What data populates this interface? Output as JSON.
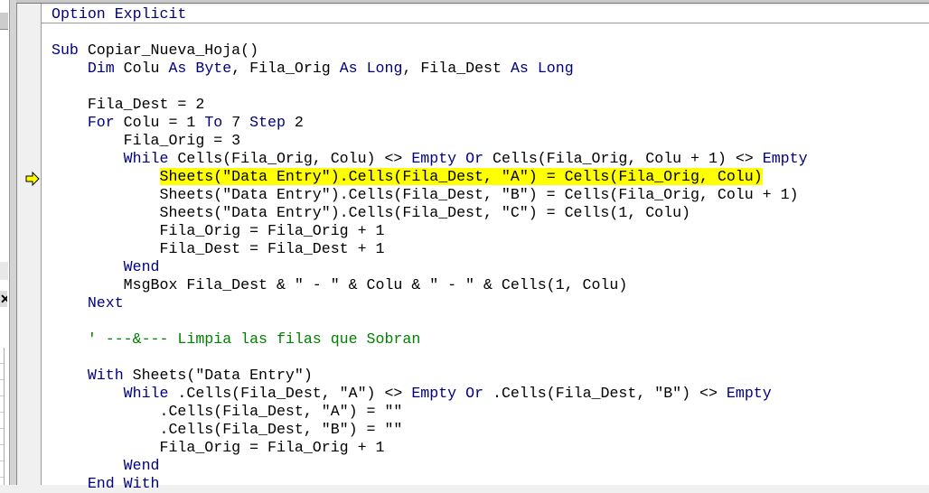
{
  "editor": {
    "execution_line": 10,
    "highlight_color": "#ffff00",
    "keyword_color": "#00007f",
    "comment_color": "#007f00",
    "lines": [
      [
        [
          "k",
          "Option Explicit"
        ]
      ],
      [],
      [
        [
          "k",
          "Sub"
        ],
        [
          "n",
          " Copiar_Nueva_Hoja()"
        ]
      ],
      [
        [
          "n",
          "    "
        ],
        [
          "k",
          "Dim"
        ],
        [
          "n",
          " Colu "
        ],
        [
          "k",
          "As"
        ],
        [
          "n",
          " "
        ],
        [
          "k",
          "Byte"
        ],
        [
          "n",
          ", Fila_Orig "
        ],
        [
          "k",
          "As"
        ],
        [
          "n",
          " "
        ],
        [
          "k",
          "Long"
        ],
        [
          "n",
          ", Fila_Dest "
        ],
        [
          "k",
          "As"
        ],
        [
          "n",
          " "
        ],
        [
          "k",
          "Long"
        ]
      ],
      [],
      [
        [
          "n",
          "    Fila_Dest = 2"
        ]
      ],
      [
        [
          "n",
          "    "
        ],
        [
          "k",
          "For"
        ],
        [
          "n",
          " Colu = 1 "
        ],
        [
          "k",
          "To"
        ],
        [
          "n",
          " 7 "
        ],
        [
          "k",
          "Step"
        ],
        [
          "n",
          " 2"
        ]
      ],
      [
        [
          "n",
          "        Fila_Orig = 3"
        ]
      ],
      [
        [
          "n",
          "        "
        ],
        [
          "k",
          "While"
        ],
        [
          "n",
          " Cells(Fila_Orig, Colu) <> "
        ],
        [
          "k",
          "Empty"
        ],
        [
          "n",
          " "
        ],
        [
          "k",
          "Or"
        ],
        [
          "n",
          " Cells(Fila_Orig, Colu + 1) <> "
        ],
        [
          "k",
          "Empty"
        ]
      ],
      [
        [
          "n",
          "            "
        ],
        [
          "h",
          "Sheets(\"Data Entry\").Cells(Fila_Dest, \"A\") = Cells(Fila_Orig, Colu)"
        ]
      ],
      [
        [
          "n",
          "            Sheets(\"Data Entry\").Cells(Fila_Dest, \"B\") = Cells(Fila_Orig, Colu + 1)"
        ]
      ],
      [
        [
          "n",
          "            Sheets(\"Data Entry\").Cells(Fila_Dest, \"C\") = Cells(1, Colu)"
        ]
      ],
      [
        [
          "n",
          "            Fila_Orig = Fila_Orig + 1"
        ]
      ],
      [
        [
          "n",
          "            Fila_Dest = Fila_Dest + 1"
        ]
      ],
      [
        [
          "n",
          "        "
        ],
        [
          "k",
          "Wend"
        ]
      ],
      [
        [
          "n",
          "        MsgBox Fila_Dest & \" - \" & Colu & \" - \" & Cells(1, Colu)"
        ]
      ],
      [
        [
          "n",
          "    "
        ],
        [
          "k",
          "Next"
        ]
      ],
      [],
      [
        [
          "n",
          "    "
        ],
        [
          "c",
          "' ---&--- Limpia las filas que Sobran"
        ]
      ],
      [],
      [
        [
          "n",
          "    "
        ],
        [
          "k",
          "With"
        ],
        [
          "n",
          " Sheets(\"Data Entry\")"
        ]
      ],
      [
        [
          "n",
          "        "
        ],
        [
          "k",
          "While"
        ],
        [
          "n",
          " .Cells(Fila_Dest, \"A\") <> "
        ],
        [
          "k",
          "Empty"
        ],
        [
          "n",
          " "
        ],
        [
          "k",
          "Or"
        ],
        [
          "n",
          " .Cells(Fila_Dest, \"B\") <> "
        ],
        [
          "k",
          "Empty"
        ]
      ],
      [
        [
          "n",
          "            .Cells(Fila_Dest, \"A\") = \"\""
        ]
      ],
      [
        [
          "n",
          "            .Cells(Fila_Dest, \"B\") = \"\""
        ]
      ],
      [
        [
          "n",
          "            Fila_Orig = Fila_Orig + 1"
        ]
      ],
      [
        [
          "n",
          "        "
        ],
        [
          "k",
          "Wend"
        ]
      ],
      [
        [
          "n",
          "    "
        ],
        [
          "k",
          "End With"
        ]
      ]
    ]
  },
  "margin": {
    "indicator_icon": "execution-arrow-icon",
    "indicator_color": "#ffff00"
  }
}
